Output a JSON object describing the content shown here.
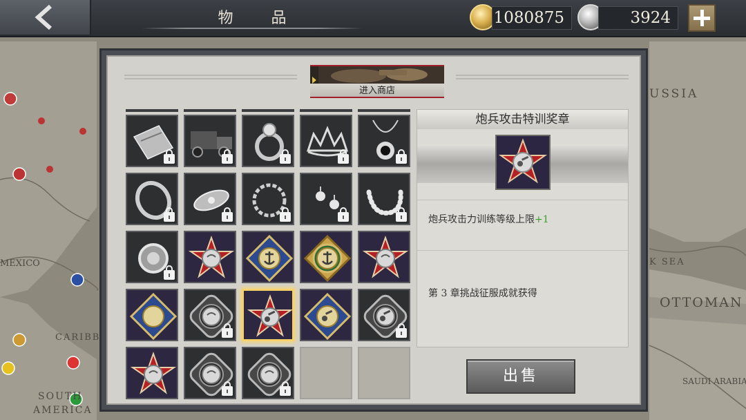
{
  "header": {
    "title": "物 品",
    "gold_amount": "1080875",
    "medal_amount": "3924"
  },
  "shop": {
    "label": "进入商店"
  },
  "map_labels": {
    "russia": "USSIA",
    "mexico": "MEXICO",
    "caribbean": "CARIBB",
    "black_sea": "K SEA",
    "ottoman": "OTTOMAN",
    "saudi": "SAUDI ARABIA",
    "south_america_1": "SOUTH",
    "south_america_2": "AMERICA"
  },
  "inventory": {
    "items": [
      {
        "icon": "envelope-icon",
        "locked": true
      },
      {
        "icon": "truck-icon",
        "locked": true
      },
      {
        "icon": "ring-icon",
        "locked": true
      },
      {
        "icon": "tiara-icon",
        "locked": true
      },
      {
        "icon": "necklace-icon",
        "locked": true
      },
      {
        "icon": "bracelet-icon",
        "locked": true
      },
      {
        "icon": "brooch-icon",
        "locked": true
      },
      {
        "icon": "chain-bracelet-icon",
        "locked": true
      },
      {
        "icon": "earrings-icon",
        "locked": true
      },
      {
        "icon": "pearl-necklace-icon",
        "locked": true
      },
      {
        "icon": "silver-ring-icon",
        "locked": true
      },
      {
        "icon": "red-star-medal-icon",
        "locked": false
      },
      {
        "icon": "blue-anchor-medal-icon",
        "locked": false
      },
      {
        "icon": "green-anchor-medal-icon",
        "locked": false
      },
      {
        "icon": "red-star-medal-icon",
        "locked": false
      },
      {
        "icon": "blue-medal-icon",
        "locked": false
      },
      {
        "icon": "gray-medal-icon",
        "locked": true
      },
      {
        "icon": "red-star-cannon-medal-icon",
        "locked": false
      },
      {
        "icon": "blue-cannon-medal-icon",
        "locked": false
      },
      {
        "icon": "gray-cannon-medal-icon",
        "locked": true
      },
      {
        "icon": "red-star-medal-icon",
        "locked": false
      },
      {
        "icon": "gray-medal-icon",
        "locked": true
      },
      {
        "icon": "gray-medal-icon",
        "locked": true
      },
      {
        "icon": "empty-slot",
        "locked": false
      },
      {
        "icon": "empty-slot",
        "locked": false
      }
    ],
    "selected_index": 17
  },
  "detail": {
    "title": "炮兵攻击特训奖章",
    "icon": "red-star-cannon-medal-icon",
    "effect_text": "炮兵攻击力训练等级上限",
    "effect_bonus": "+1",
    "source_text": "第 3 章挑战征服成就获得"
  },
  "actions": {
    "sell_label": "出售"
  },
  "colors": {
    "accent_gold": "#f5d36a",
    "bonus_green": "#3a9b2f",
    "shop_border": "#a3202a"
  }
}
